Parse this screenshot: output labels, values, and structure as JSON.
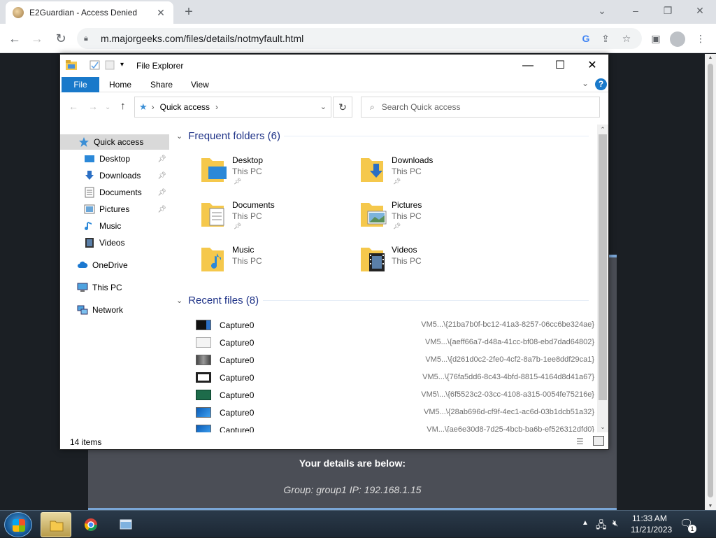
{
  "browser": {
    "tab_title": "E2Guardian - Access Denied",
    "url": "m.majorgeeks.com/files/details/notmyfault.html"
  },
  "page": {
    "heading": "Your details are below:",
    "details": "Group: group1   IP: 192.168.1.15"
  },
  "explorer": {
    "window_title": "File Explorer",
    "ribbon_tabs": {
      "file": "File",
      "home": "Home",
      "share": "Share",
      "view": "View"
    },
    "address_crumb": "Quick access",
    "search_placeholder": "Search Quick access",
    "nav": [
      {
        "label": "Quick access",
        "icon": "star-icon",
        "pinned": false
      },
      {
        "label": "Desktop",
        "icon": "desktop-icon",
        "pinned": true
      },
      {
        "label": "Downloads",
        "icon": "download-icon",
        "pinned": true
      },
      {
        "label": "Documents",
        "icon": "document-icon",
        "pinned": true
      },
      {
        "label": "Pictures",
        "icon": "picture-icon",
        "pinned": true
      },
      {
        "label": "Music",
        "icon": "music-icon",
        "pinned": false
      },
      {
        "label": "Videos",
        "icon": "video-icon",
        "pinned": false
      },
      {
        "label": "OneDrive",
        "icon": "cloud-icon",
        "pinned": false
      },
      {
        "label": "This PC",
        "icon": "computer-icon",
        "pinned": false
      },
      {
        "label": "Network",
        "icon": "network-icon",
        "pinned": false
      }
    ],
    "frequent_header": "Frequent folders (6)",
    "frequent": [
      {
        "name": "Desktop",
        "location": "This PC",
        "pinned": true
      },
      {
        "name": "Downloads",
        "location": "This PC",
        "pinned": true
      },
      {
        "name": "Documents",
        "location": "This PC",
        "pinned": true
      },
      {
        "name": "Pictures",
        "location": "This PC",
        "pinned": true
      },
      {
        "name": "Music",
        "location": "This PC",
        "pinned": false
      },
      {
        "name": "Videos",
        "location": "This PC",
        "pinned": false
      }
    ],
    "recent_header": "Recent files (8)",
    "recent": [
      {
        "name": "Capture0",
        "path": "VM5...\\{21ba7b0f-bc12-41a3-8257-06cc6be324ae}"
      },
      {
        "name": "Capture0",
        "path": "VM5...\\{aeff66a7-d48a-41cc-bf08-ebd7dad64802}"
      },
      {
        "name": "Capture0",
        "path": "VM5...\\{d261d0c2-2fe0-4cf2-8a7b-1ee8ddf29ca1}"
      },
      {
        "name": "Capture0",
        "path": "VM5...\\{76fa5dd6-8c43-4bfd-8815-4164d8d41a67}"
      },
      {
        "name": "Capture0",
        "path": "VM5\\...\\{6f5523c2-03cc-4108-a315-0054fe75216e}"
      },
      {
        "name": "Capture0",
        "path": "VM5...\\{28ab696d-cf9f-4ec1-ac6d-03b1dcb51a32}"
      },
      {
        "name": "Capture0",
        "path": "VM...\\{ae6e30d8-7d25-4bcb-ba6b-ef526312dfd0}"
      }
    ],
    "status_count": "14 items"
  },
  "taskbar": {
    "time": "11:33 AM",
    "date": "11/21/2023",
    "notification_count": "1"
  },
  "colors": {
    "accent": "#1979ca",
    "group_header": "#1e3287",
    "folder": "#f5c84c"
  }
}
